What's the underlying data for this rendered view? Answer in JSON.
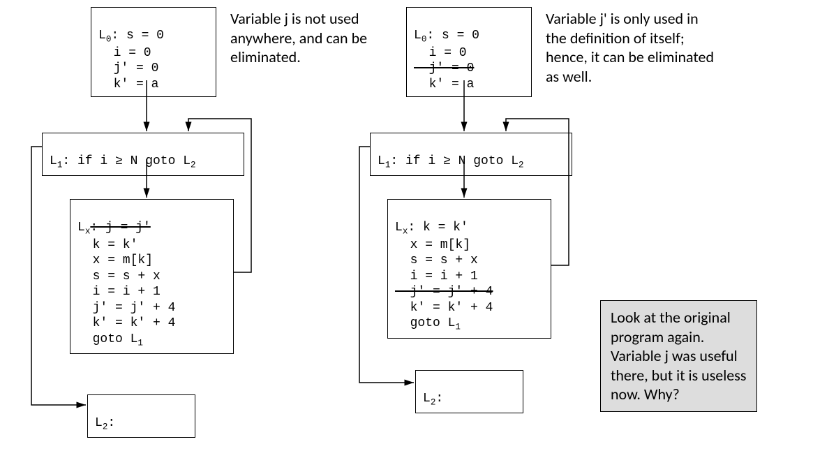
{
  "left": {
    "L0": {
      "label": "L",
      "sub": "0",
      "lines": [
        ": s = 0",
        "  i = 0",
        "  j' = 0",
        "  k' = a"
      ]
    },
    "L1": {
      "label": "L",
      "sub": "1",
      "text": ": if i ≥ N goto L",
      "sub2": "2"
    },
    "Lx": {
      "label": "L",
      "sub": "x",
      "line1_strike": ": j = j'",
      "rest": "  k = k'\n  x = m[k]\n  s = s + x\n  i = i + 1\n  j' = j' + 4\n  k' = k' + 4\n  goto L",
      "goto_sub": "1"
    },
    "L2": {
      "label": "L",
      "sub": "2",
      "text": ":"
    },
    "caption": "Variable j is not used anywhere, and can be eliminated."
  },
  "right": {
    "L0": {
      "label": "L",
      "sub": "0",
      "line1": ": s = 0",
      "line2": "  i = 0",
      "line3_strike": "  j' = 0",
      "line4": "  k' = a"
    },
    "L1": {
      "label": "L",
      "sub": "1",
      "text": ": if i ≥ N goto L",
      "sub2": "2"
    },
    "Lx": {
      "label": "L",
      "sub": "x",
      "line1": ": k = k'",
      "lines_mid": "  x = m[k]\n  s = s + x\n  i = i + 1",
      "line_strike": "  j' = j' + 4",
      "lines_end": "  k' = k' + 4\n  goto L",
      "goto_sub": "1"
    },
    "L2": {
      "label": "L",
      "sub": "2",
      "text": ":"
    },
    "caption": "Variable j' is only used in the definition of itself; hence, it can be eliminated as well."
  },
  "note": "Look at the original program again. Variable j was useful there, but it is useless now. Why?"
}
